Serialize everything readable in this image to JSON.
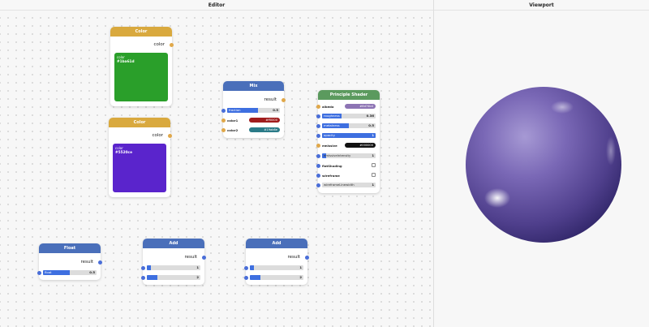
{
  "panes": {
    "editor_title": "Editor",
    "viewport_title": "Viewport"
  },
  "colors": {
    "node_header_color": "#d9a93e",
    "node_header_blue": "#4a6fba",
    "node_header_green": "#5b9a5e",
    "socket_orange": "#e0a84a",
    "socket_blue": "#4a6ed8",
    "fill_blue": "#3e6fe0",
    "sphere": "#6f5aa8"
  },
  "color_node_1": {
    "title": "Color",
    "output": "color",
    "swatch_label": "color",
    "swatch_hex": "#1ba61d",
    "swatch_color": "#2a9f2a"
  },
  "color_node_2": {
    "title": "Color",
    "output": "color",
    "swatch_label": "color",
    "swatch_hex": "#5520ce",
    "swatch_color": "#5a24cc"
  },
  "mix_node": {
    "title": "Mix",
    "output": "result",
    "fraction_label": "fraction",
    "fraction_value": "0.5",
    "fraction_fill": 0.5,
    "color1_label": "color1",
    "color1_value": "#ff0000",
    "color1_swatch": "#a01c1c",
    "color2_label": "color2",
    "color2_value": "#19ab6e",
    "color2_swatch": "#2b7b88"
  },
  "shader_node": {
    "title": "Principle Shader",
    "albedo_label": "albedo",
    "albedo_value": "#8d74b4",
    "albedo_swatch": "#8d74b4",
    "roughness_label": "roughness",
    "roughness_value": "0.36",
    "roughness_fill": 0.36,
    "metalness_label": "metalness",
    "metalness_value": "0.5",
    "metalness_fill": 0.5,
    "opacity_label": "opacity",
    "opacity_value": "1",
    "opacity_fill": 1.0,
    "emissive_label": "emissive",
    "emissive_value": "#000000",
    "emissive_intensity_label": "emissiveIntensity",
    "emissive_intensity_value": "1",
    "emissive_intensity_fill": 0.05,
    "flat_shading_label": "flatShading",
    "flat_shading_checked": false,
    "wireframe_label": "wireframe",
    "wireframe_checked": false,
    "wireframe_linewidth_label": "wireframeLinewidth",
    "wireframe_linewidth_value": "1",
    "wireframe_linewidth_fill": 0.0
  },
  "float_node": {
    "title": "Float",
    "output": "result",
    "value_label": "float",
    "value": "0.5",
    "fill": 0.5
  },
  "add_node_1": {
    "title": "Add",
    "output": "result",
    "a_value": "1",
    "a_fill": 0.05,
    "b_value": "2",
    "b_fill": 0.1
  },
  "add_node_2": {
    "title": "Add",
    "output": "result",
    "a_value": "1",
    "a_fill": 0.05,
    "b_value": "2",
    "b_fill": 0.1
  }
}
